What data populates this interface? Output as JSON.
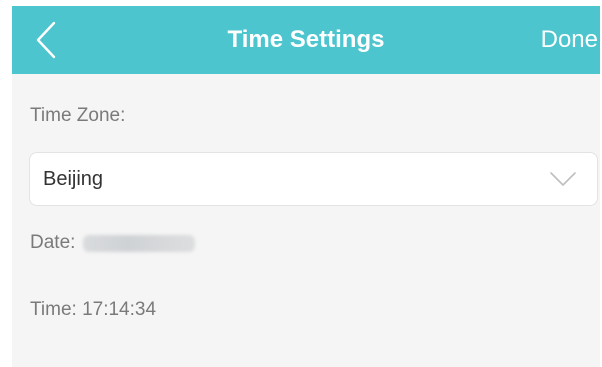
{
  "header": {
    "title": "Time Settings",
    "done_label": "Done",
    "back_icon": "chevron-left-icon",
    "background_color": "#4dc5cf"
  },
  "time_zone": {
    "label": "Time Zone:",
    "selected": "Beijing",
    "dropdown_icon": "chevron-down-icon"
  },
  "date": {
    "label": "Date:"
  },
  "time": {
    "text": "Time: 17:14:34"
  }
}
